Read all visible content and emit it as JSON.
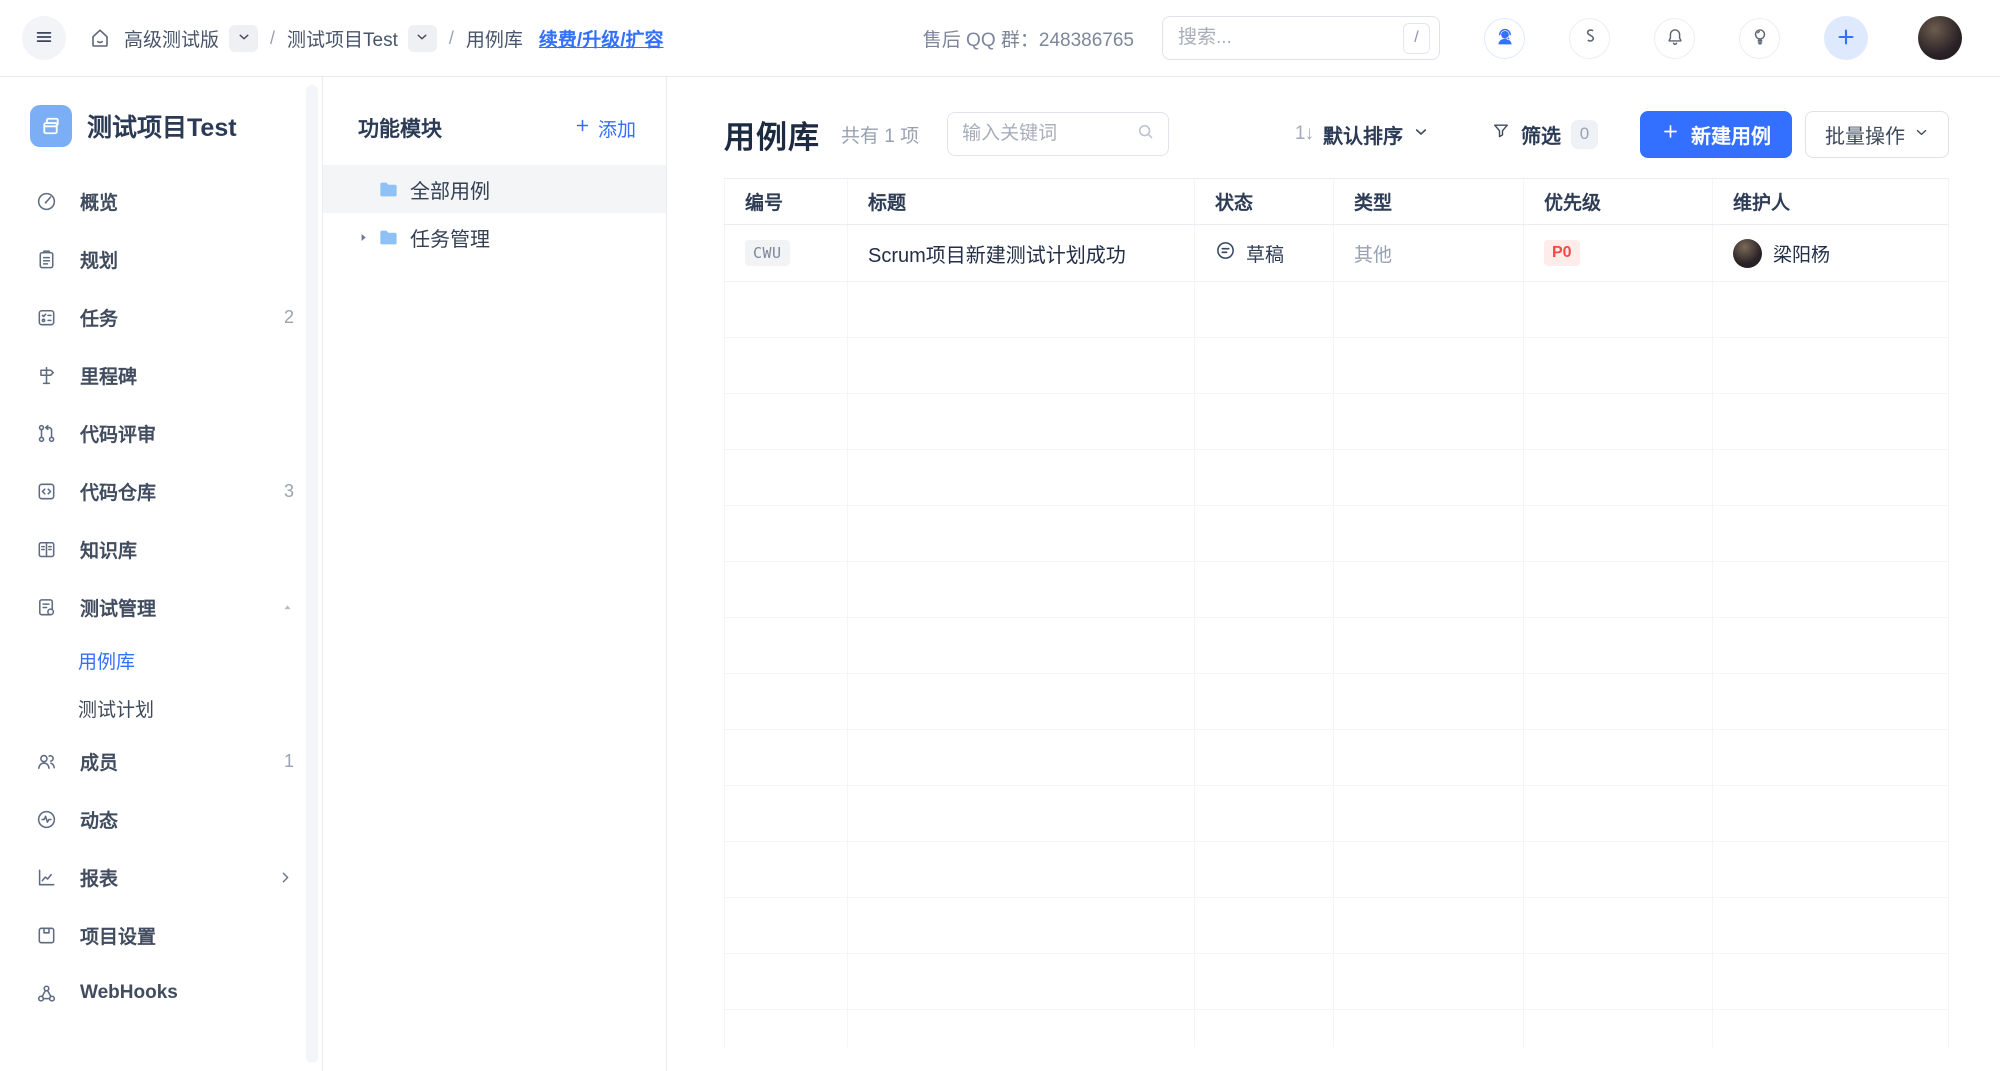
{
  "colors": {
    "accent_blue": "#3370ff",
    "priority_red": "#f54a45",
    "priority_bg": "#feeceb",
    "folder_blue": "#8ec1f5",
    "project_icon_bg": "#7caef5"
  },
  "topbar": {
    "breadcrumb": {
      "org": "高级测试版",
      "project": "测试项目Test",
      "page": "用例库",
      "sep": "/"
    },
    "upgrade_link": "续费/升级/扩容",
    "qq_label": "售后 QQ 群：248386765",
    "search_placeholder": "搜索...",
    "search_shortcut": "/"
  },
  "sidebar": {
    "project_title": "测试项目Test",
    "items": [
      {
        "key": "overview",
        "icon": "gauge-icon",
        "label": "概览"
      },
      {
        "key": "planning",
        "icon": "clipboard-icon",
        "label": "规划"
      },
      {
        "key": "tasks",
        "icon": "task-list-icon",
        "label": "任务",
        "badge": "2"
      },
      {
        "key": "milestones",
        "icon": "milestone-icon",
        "label": "里程碑"
      },
      {
        "key": "code-review",
        "icon": "pull-request-icon",
        "label": "代码评审"
      },
      {
        "key": "code-repo",
        "icon": "code-repo-icon",
        "label": "代码仓库",
        "badge": "3"
      },
      {
        "key": "wiki",
        "icon": "book-icon",
        "label": "知识库"
      },
      {
        "key": "test-management",
        "icon": "test-doc-icon",
        "label": "测试管理",
        "expanded": true,
        "children": [
          {
            "key": "case-library",
            "label": "用例库",
            "active": true
          },
          {
            "key": "test-plans",
            "label": "测试计划"
          }
        ]
      },
      {
        "key": "members",
        "icon": "members-icon",
        "label": "成员",
        "badge": "1"
      },
      {
        "key": "activity",
        "icon": "pulse-icon",
        "label": "动态"
      },
      {
        "key": "reports",
        "icon": "chart-icon",
        "label": "报表",
        "has_submenu": true
      },
      {
        "key": "project-settings",
        "icon": "save-icon",
        "label": "项目设置"
      },
      {
        "key": "webhooks",
        "icon": "nodes-icon",
        "label": "WebHooks"
      }
    ]
  },
  "modules_panel": {
    "title": "功能模块",
    "add_label": "添加",
    "items": [
      {
        "key": "all-cases",
        "label": "全部用例",
        "selected": true,
        "collapsible": false
      },
      {
        "key": "task-management",
        "label": "任务管理",
        "selected": false,
        "collapsible": true
      }
    ]
  },
  "main": {
    "title": "用例库",
    "count_label": "共有 1 项",
    "keyword_placeholder": "输入关键词",
    "sort_icon_text": "1↓",
    "sort_label": "默认排序",
    "filter_label": "筛选",
    "filter_count": "0",
    "new_button": "新建用例",
    "batch_button": "批量操作",
    "table": {
      "columns": [
        "编号",
        "标题",
        "状态",
        "类型",
        "优先级",
        "维护人"
      ],
      "column_keys": [
        "id",
        "title",
        "status",
        "type",
        "priority",
        "owner"
      ],
      "rows": [
        {
          "id": "CWU",
          "title": "Scrum项目新建测试计划成功",
          "status": "草稿",
          "type": "其他",
          "priority": "P0",
          "owner": "梁阳杨"
        }
      ],
      "empty_row_count": 14
    }
  }
}
